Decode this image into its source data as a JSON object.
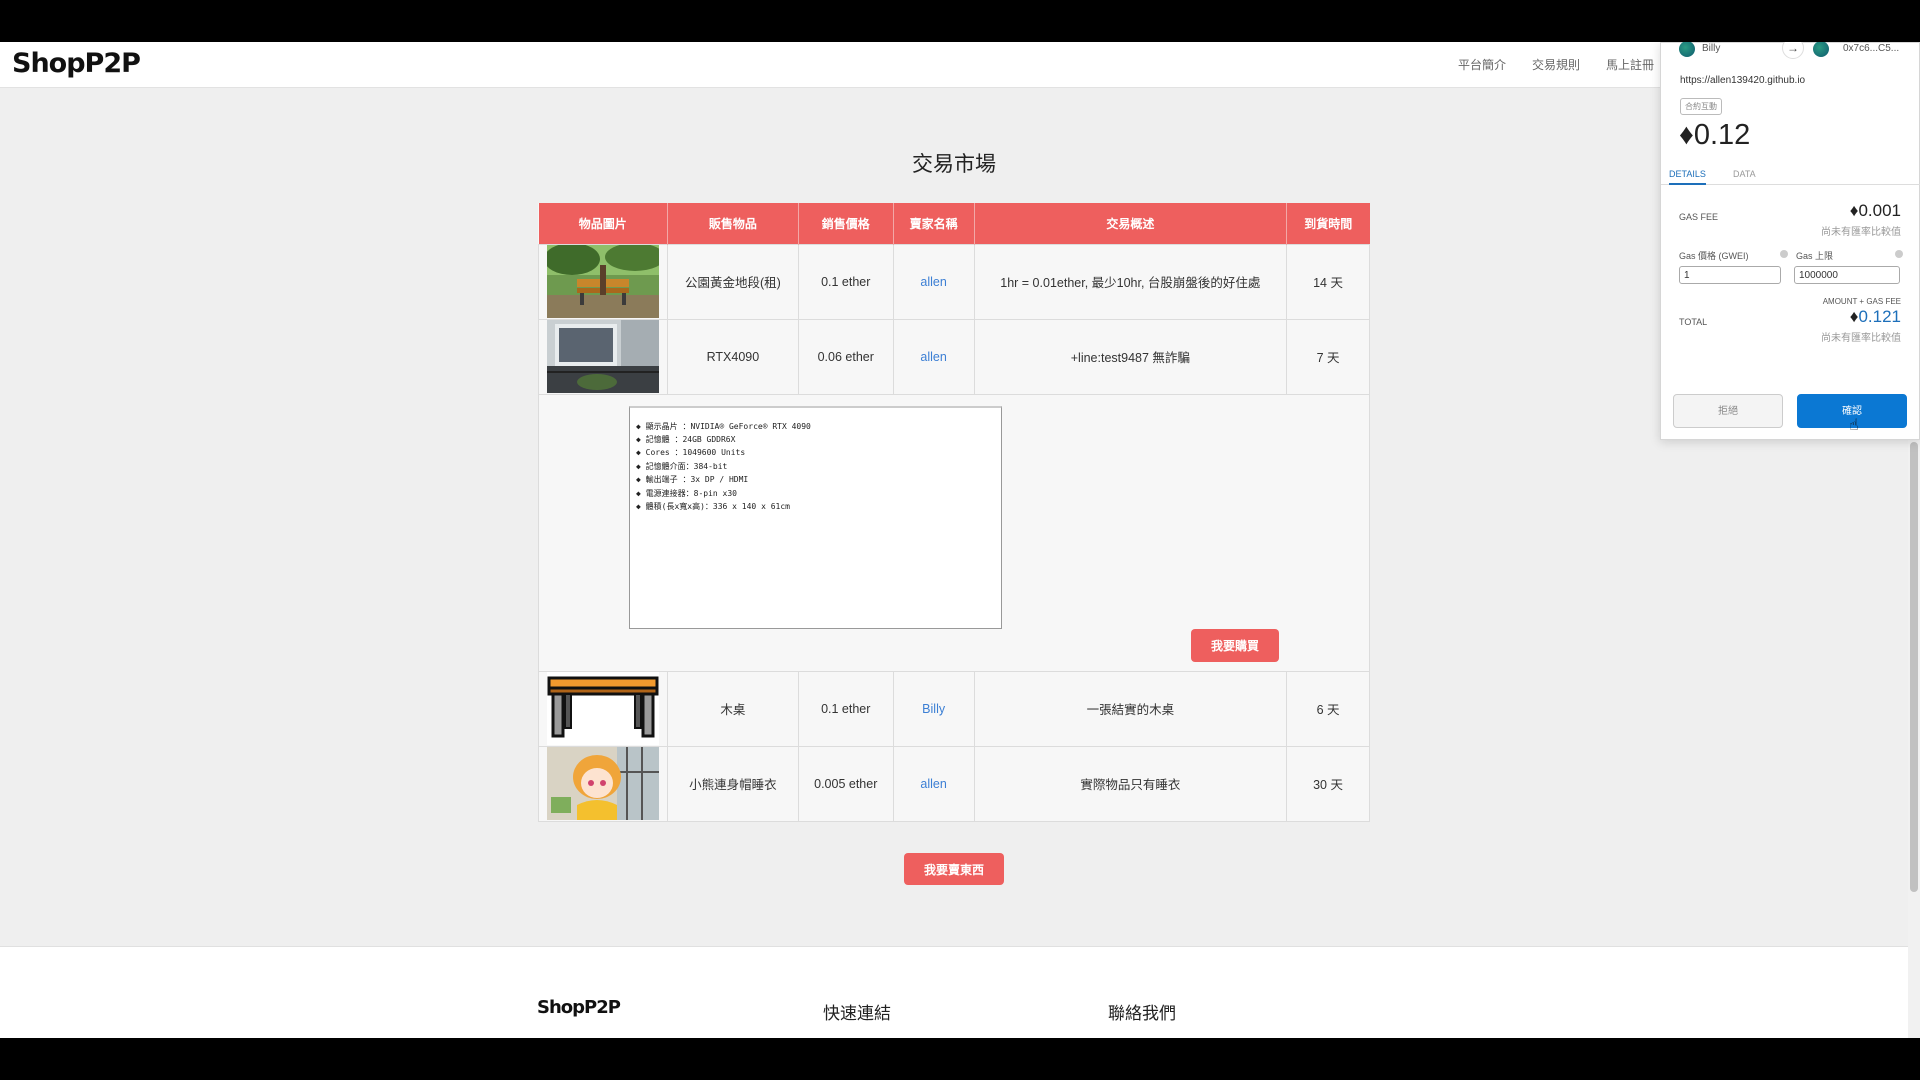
{
  "navbar": {
    "brand": "ShopP2P",
    "links": [
      "平台簡介",
      "交易規則",
      "馬上註冊"
    ]
  },
  "market": {
    "title": "交易市場",
    "headers": [
      "物品圖片",
      "販售物品",
      "銷售價格",
      "賣家名稱",
      "交易概述",
      "到貨時間"
    ],
    "rows": [
      {
        "name": "公園黃金地段(租)",
        "price": "0.1 ether",
        "seller": "allen",
        "summary": "1hr = 0.01ether, 最少10hr, 台股崩盤後的好住處",
        "delivery": "14 天",
        "image_icon": "park-bench-photo"
      },
      {
        "name": "RTX4090",
        "price": "0.06 ether",
        "seller": "allen",
        "summary": "+line:test9487 無詐騙",
        "delivery": "7 天",
        "image_icon": "balcony-photo"
      },
      {
        "name": "木桌",
        "price": "0.1 ether",
        "seller": "Billy",
        "summary": "一張結實的木桌",
        "delivery": "6 天",
        "image_icon": "wooden-table-icon"
      },
      {
        "name": "小熊連身帽睡衣",
        "price": "0.005 ether",
        "seller": "allen",
        "summary": "實際物品只有睡衣",
        "delivery": "30 天",
        "image_icon": "anime-girl-photo"
      }
    ],
    "spec_lines": [
      "顯示晶片 ：NVIDIA® GeForce® RTX 4090",
      "記憶體 ：24GB GDDR6X",
      "Cores ：1049600 Units",
      "記憶體介面：384-bit",
      "輸出端子 ：3x DP / HDMI",
      "電源連接器：8-pin x30",
      "體積(長x寬x高)：336 x 140 x 61cm"
    ],
    "buy_label": "我要購買",
    "sell_label": "我要賣東西"
  },
  "footer": {
    "brand": "ShopP2P",
    "quick_links": "快速連結",
    "contact": "聯絡我們"
  },
  "metamask": {
    "from_account": "Billy",
    "to_account": "0x7c6...C5...",
    "origin": "https://allen139420.github.io",
    "badge": "合約互動",
    "amount": "0.12",
    "tabs": [
      "DETAILS",
      "DATA"
    ],
    "gas_fee_label": "GAS FEE",
    "gas_fee_value": "0.001",
    "gas_fee_note": "尚未有匯率比較值",
    "gas_price_label": "Gas 價格 (GWEI)",
    "gas_price_value": "1",
    "gas_limit_label": "Gas 上限",
    "gas_limit_value": "1000000",
    "amount_plus_gas": "AMOUNT + GAS FEE",
    "total_label": "TOTAL",
    "total_value": "0.121",
    "total_note": "尚未有匯率比較值",
    "reject_label": "拒絕",
    "confirm_label": "確認",
    "eth_symbol": "♦"
  }
}
